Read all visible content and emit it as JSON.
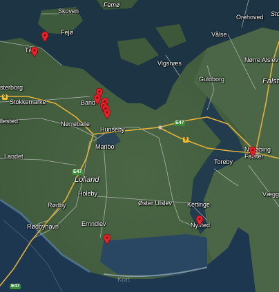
{
  "map": {
    "colors": {
      "sea": "#1c3345",
      "land": "#3e5a3c",
      "road_major": "#e7b73b",
      "road_minor": "#d9d9d9",
      "marker": "#e8232b"
    },
    "places": {
      "femo": "Femø",
      "skoven": "Skoven",
      "fejo": "Fejø",
      "orehoved": "Orehoved",
      "stor": "Sto",
      "valse": "Vålse",
      "tars": "Tårs",
      "norre_alslev": "Nørre Alslev",
      "vigsnaes": "Vigsnæs",
      "falster": "Falst",
      "guldborg": "Guldborg",
      "sterborg": "sterborg",
      "stokkemarke": "Stokkemarke",
      "bandholm": "Band",
      "nørreballe": "Nørreballe",
      "hunseby": "Hunseby",
      "allested": "llested",
      "maribo": "Maribo",
      "landet": "Landet",
      "nykobing_falster": "Nykøbing\nFalster",
      "toreby": "Toreby",
      "vaeggerlose": "Vægg",
      "lolland": "Lolland",
      "holeby": "Holeby",
      "oster_ulslev": "Øster Ulslev",
      "kettinge": "Kettinge",
      "rodby": "Rødby",
      "nysted": "Nysted",
      "errindlev": "Errindlev",
      "rodbyhavn": "Rødbyhavn"
    },
    "roads": {
      "r9_west": "9",
      "e47_east": "E47",
      "r9_mid": "9",
      "e47_mid": "E47",
      "e47_sw": "E47"
    },
    "markers": [
      "tars-marker",
      "fejo-marker",
      "bandholm-marker-1",
      "bandholm-marker-2",
      "bandholm-marker-3",
      "bandholm-marker-4",
      "bandholm-marker-5",
      "bandholm-marker-6",
      "nykobing-marker",
      "nysted-marker",
      "errindlev-marker"
    ],
    "watermark": "Kort"
  }
}
